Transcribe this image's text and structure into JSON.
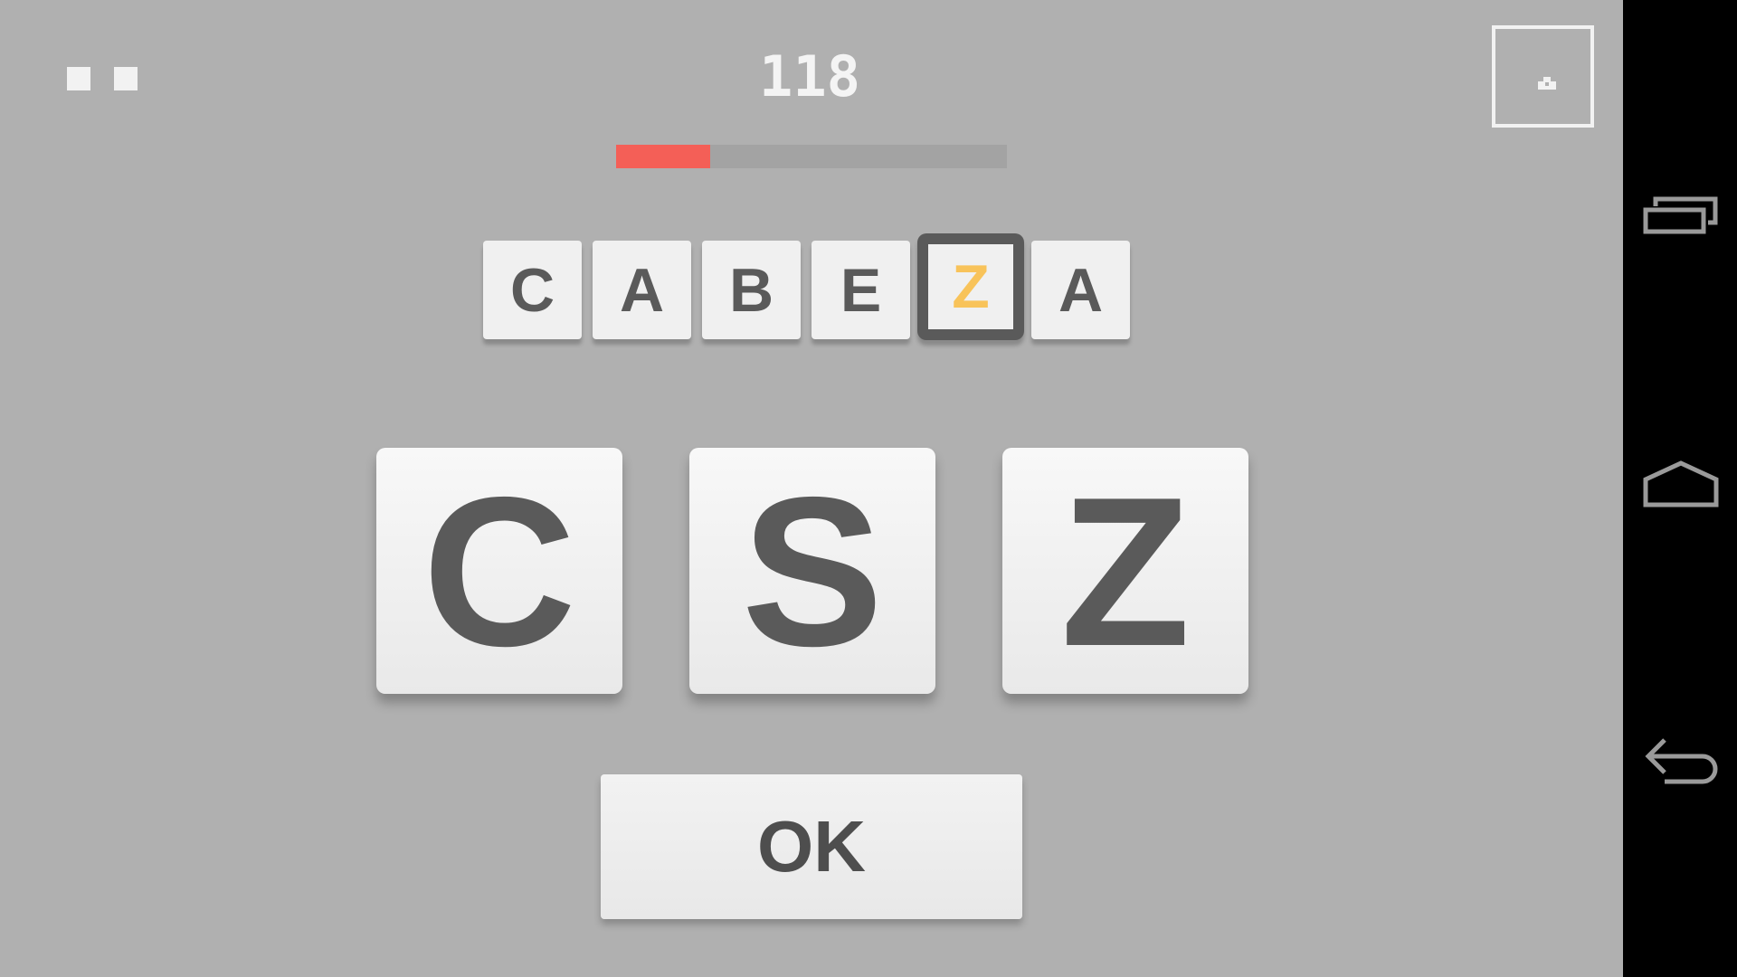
{
  "hud": {
    "score": "118",
    "progress": 0.24,
    "pause_icon": "pause-icon",
    "corner_icon": "square-hint-icon"
  },
  "word": {
    "letters": [
      "C",
      "A",
      "B",
      "E",
      "Z",
      "A"
    ],
    "active_index": 4
  },
  "choices": [
    "C",
    "S",
    "Z"
  ],
  "ok_label": "OK",
  "navbar": {
    "recent_icon": "recent-apps-icon",
    "home_icon": "home-icon",
    "back_icon": "back-icon"
  },
  "colors": {
    "background": "#b0b0b0",
    "progress_fill": "#f45f57",
    "active_letter": "#f8c35a",
    "tile_text": "#5a5a5a"
  }
}
